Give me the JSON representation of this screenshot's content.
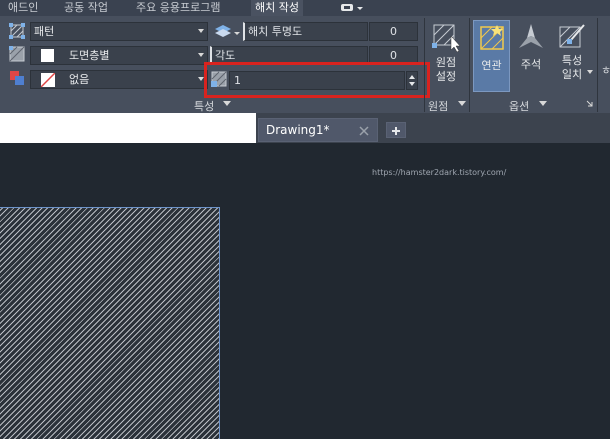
{
  "ribbon_tabs": [
    "애드인",
    "공동 작업",
    "주요 응용프로그램",
    "해치 작성"
  ],
  "active_tab": "해치 작성",
  "properties": {
    "pattern_type": "패턴",
    "background": "도면층별",
    "color": "없음",
    "transparency_label": "해치 투명도",
    "transparency_value": "0",
    "angle_label": "각도",
    "angle_value": "0",
    "scale_value": "1",
    "group_label": "특성"
  },
  "origin": {
    "button_label_1": "원점",
    "button_label_2": "설정",
    "group_label": "원점"
  },
  "options": {
    "associative": "연관",
    "annotative": "주석",
    "match_line1": "특성",
    "match_line2": "일치",
    "group_label": "옵션",
    "cut_label": "ㅎ"
  },
  "document_tabs": [
    {
      "label": "Drawing1*"
    }
  ],
  "watermark": "https://hamster2dark.tistory.com/",
  "colors": {
    "highlight_box": "#d9231f",
    "selection_edge": "#6d93c9",
    "canvas_bg": "#212830"
  }
}
